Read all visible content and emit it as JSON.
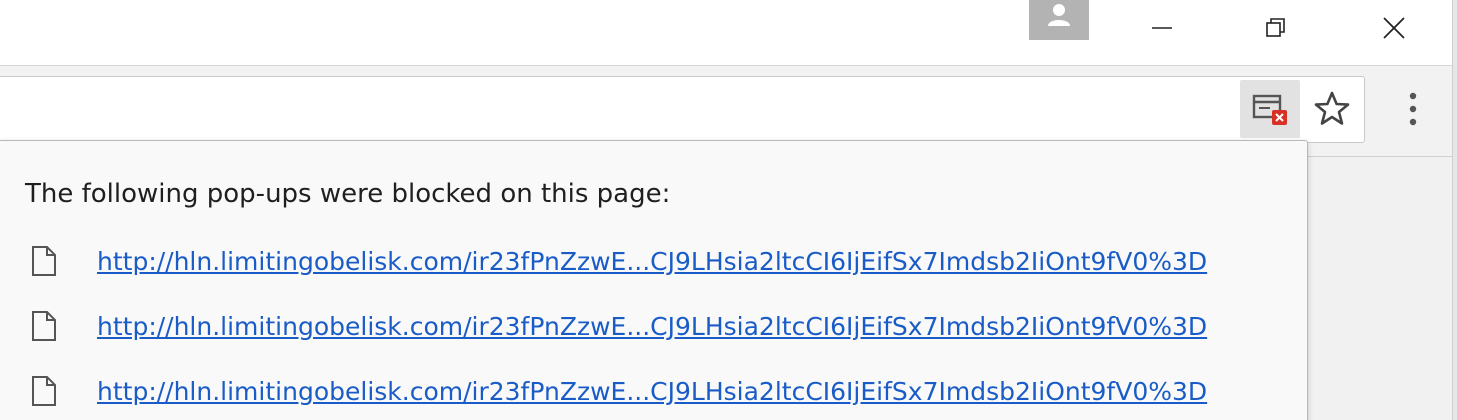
{
  "window_controls": {
    "minimize_icon": "minimize-icon",
    "restore_icon": "restore-icon",
    "close_icon": "close-icon",
    "profile_icon": "person-icon"
  },
  "toolbar": {
    "popup_blocked_icon": "popup-blocked-icon",
    "bookmark_icon": "star-icon",
    "menu_icon": "vertical-dots-icon",
    "blocked_badge_color": "#d93025"
  },
  "popup_bubble": {
    "title": "The following pop-ups were blocked on this page:",
    "item_icon": "page-icon",
    "link_color": "#1a5cc7",
    "items": [
      {
        "url": "http://hln.limitingobelisk.com/ir23fPnZzwE...CJ9LHsia2ltcCI6IjEifSx7Imdsb2IiOnt9fV0%3D"
      },
      {
        "url": "http://hln.limitingobelisk.com/ir23fPnZzwE...CJ9LHsia2ltcCI6IjEifSx7Imdsb2IiOnt9fV0%3D"
      },
      {
        "url": "http://hln.limitingobelisk.com/ir23fPnZzwE...CJ9LHsia2ltcCI6IjEifSx7Imdsb2IiOnt9fV0%3D"
      }
    ]
  }
}
